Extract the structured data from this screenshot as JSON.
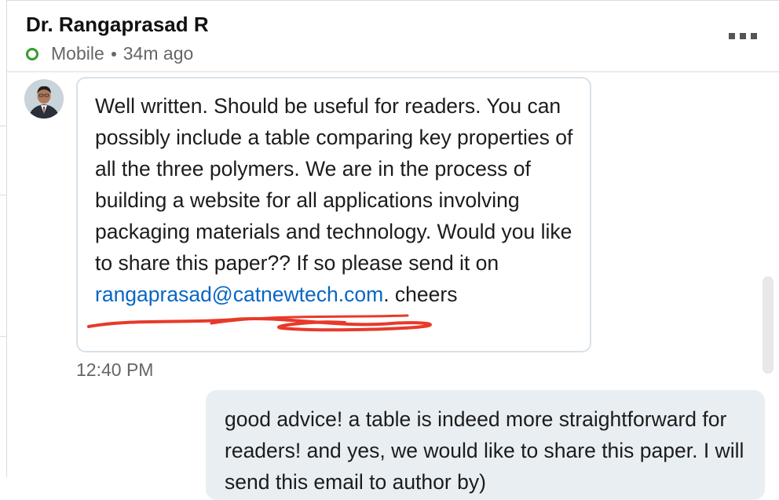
{
  "header": {
    "name": "Dr. Rangaprasad R",
    "device": "Mobile",
    "last_seen": "34m ago",
    "more_icon": "ellipsis-icon"
  },
  "messages": [
    {
      "sender": "Dr. Rangaprasad R",
      "avatar": "avatar-photo",
      "text_before": "Well written. Should be useful for readers. You can possibly include a table comparing key properties of all the three polymers. We are in the process of building a website for all applications involving packaging materials and technology. Would you like to share this paper?? If so please send it on",
      "email": "rangaprasad@catnewtech.com",
      "text_after": ". cheers",
      "time": "12:40 PM"
    },
    {
      "sender": "self",
      "text": "good advice! a table is indeed more straightforward for readers! and yes, we would like to share this paper. I will send this email to author by)"
    }
  ],
  "colors": {
    "presence": "#3a9a2d",
    "link": "#0a66c2",
    "redaction": "#e8392a",
    "reply_bg": "#e9eef2"
  }
}
